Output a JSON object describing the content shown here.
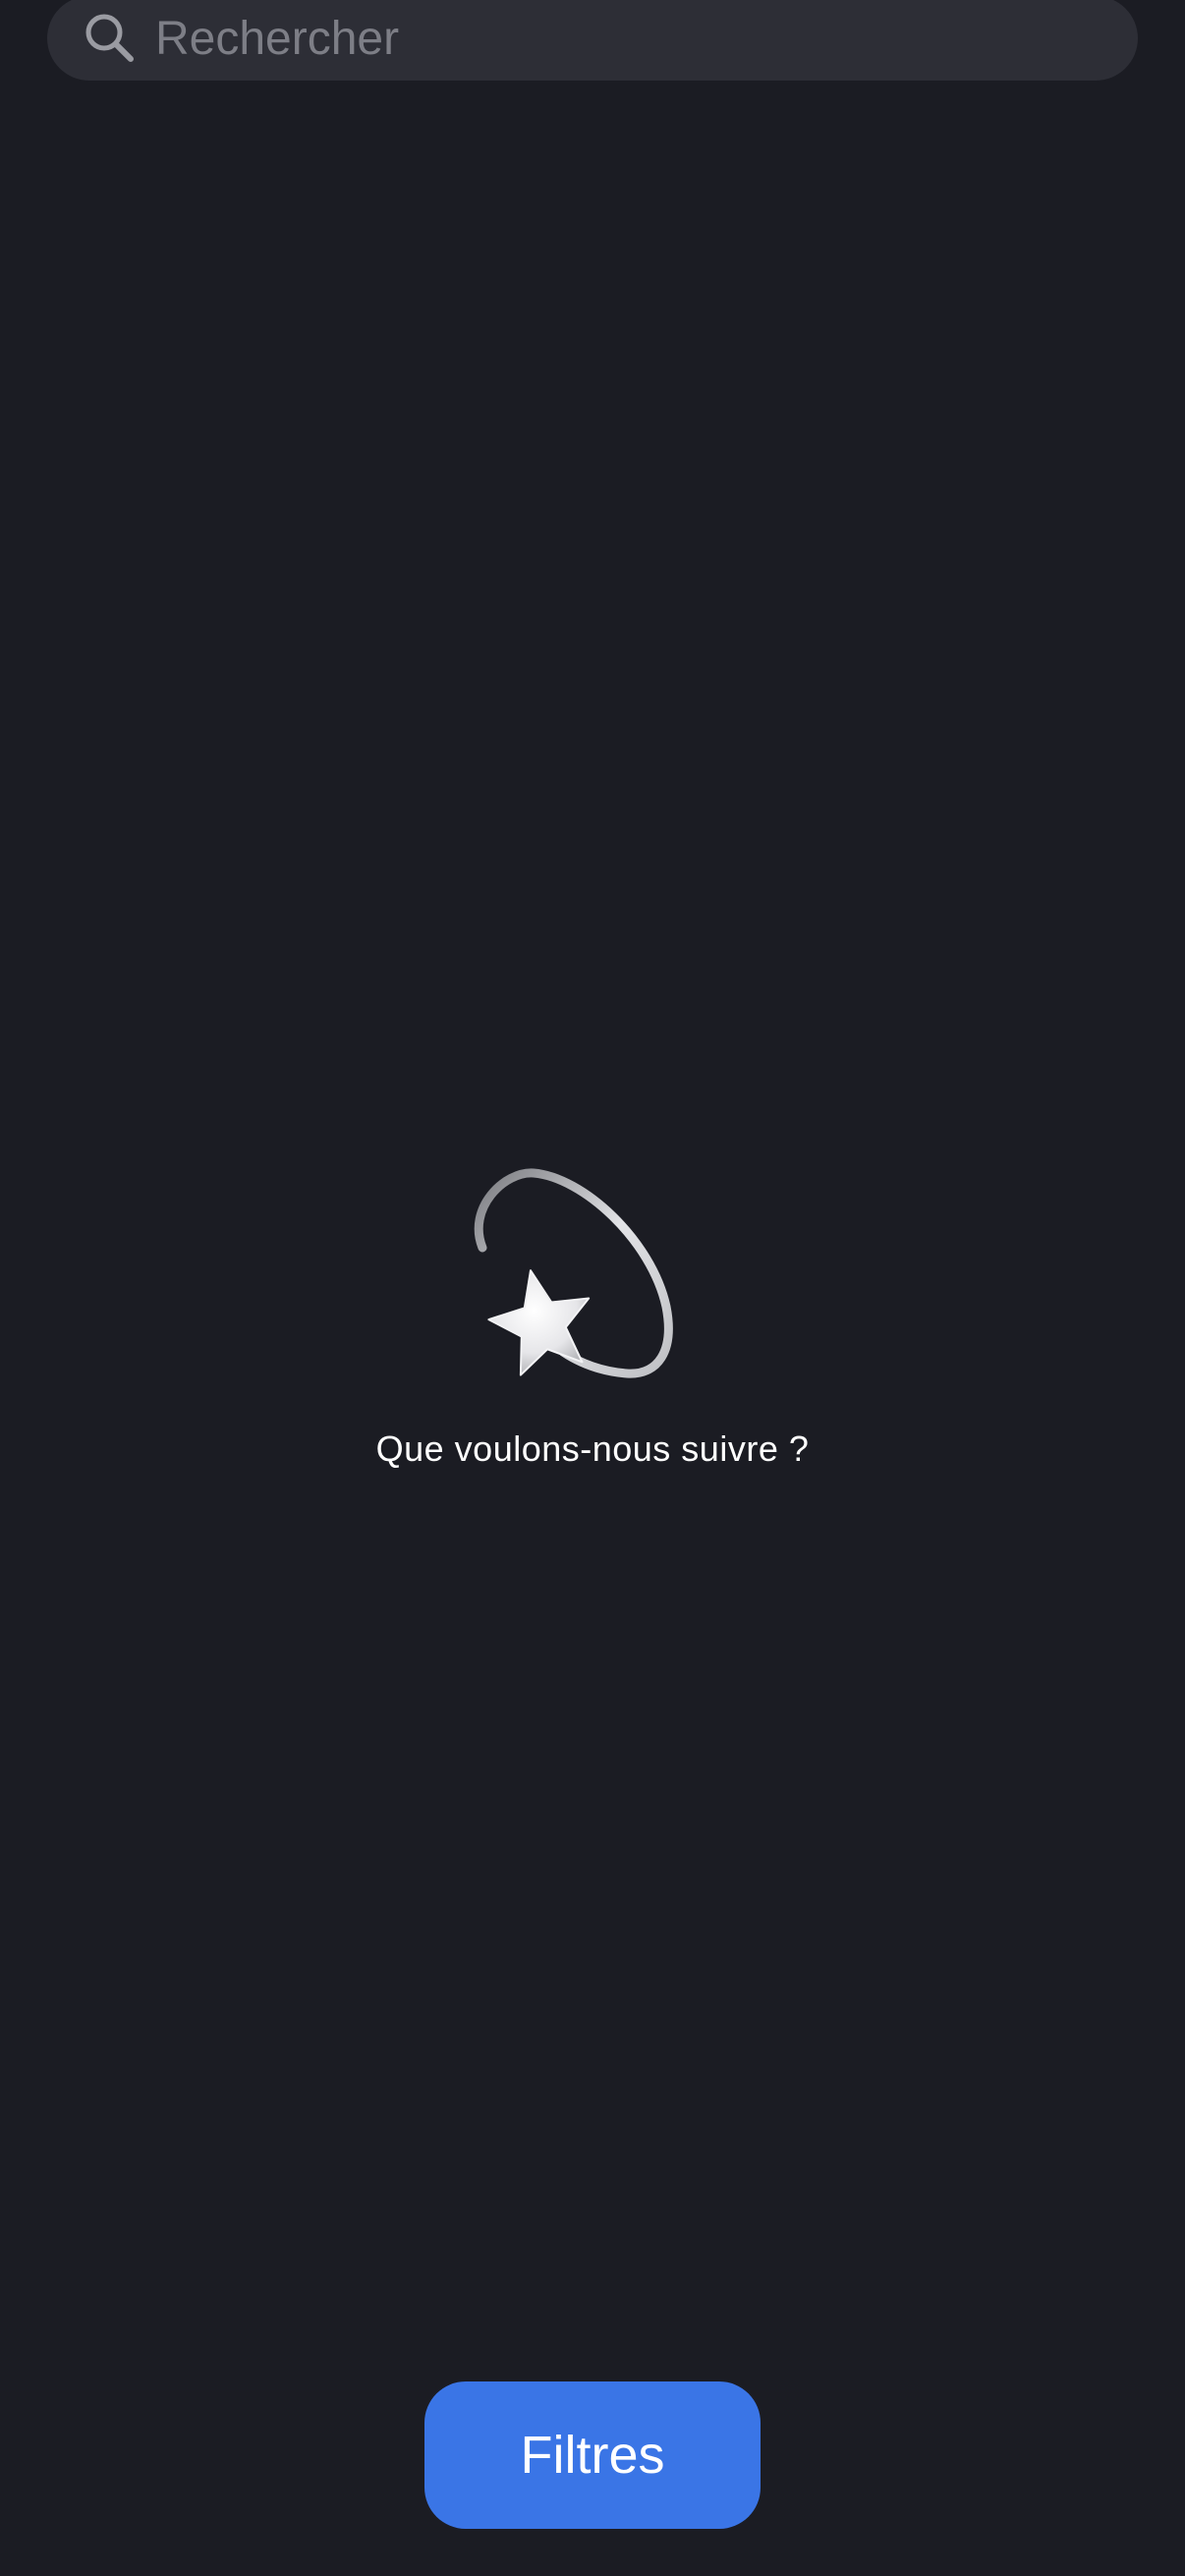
{
  "search": {
    "placeholder": "Rechercher",
    "value": "",
    "icon": "search-icon"
  },
  "empty_state": {
    "icon": "dizzy-star-icon",
    "message": "Que voulons-nous suivre ?"
  },
  "filters_button": {
    "label": "Filtres"
  },
  "colors": {
    "background": "#1b1c23",
    "search_bar": "#2d2e36",
    "placeholder": "#7d7e86",
    "accent": "#3a75e6",
    "text": "#ffffff"
  }
}
